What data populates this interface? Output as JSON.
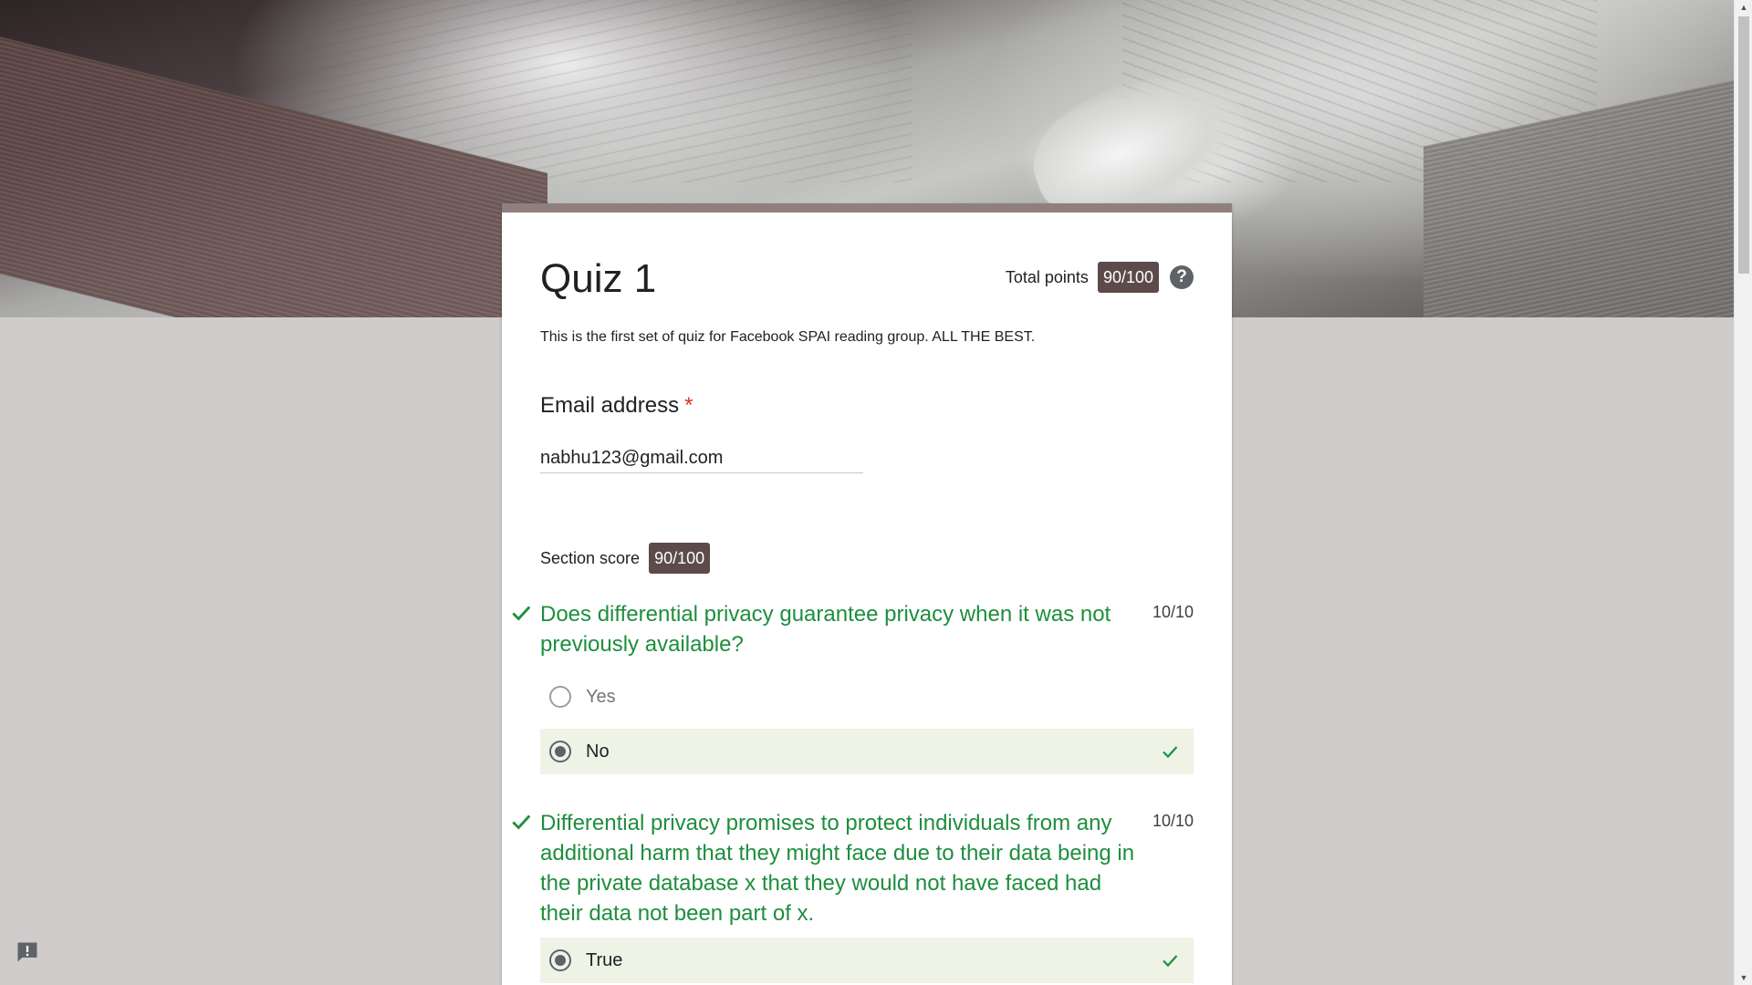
{
  "form": {
    "title": "Quiz 1",
    "total_points_label": "Total points",
    "total_points_value": "90/100",
    "help_glyph": "?",
    "description": "This is the first set of quiz for Facebook SPAI reading group. ALL THE BEST."
  },
  "email": {
    "label": "Email address",
    "required_mark": "*",
    "value": "nabhu123@gmail.com"
  },
  "section": {
    "label": "Section score",
    "value": "90/100"
  },
  "questions": [
    {
      "text": "Does differential privacy guarantee privacy when it was not previously available?",
      "points": "10/10",
      "options": [
        {
          "label": "Yes",
          "selected": false,
          "correct": false
        },
        {
          "label": "No",
          "selected": true,
          "correct": true
        }
      ]
    },
    {
      "text": "Differential privacy promises to protect individuals from any additional harm that they might face due to their data being in the private database x that they would not have faced had their data not been part of x.",
      "points": "10/10",
      "options": [
        {
          "label": "True",
          "selected": true,
          "correct": true
        }
      ]
    }
  ],
  "colors": {
    "theme": "#8f7f7d",
    "badge": "#5c4b4a",
    "correct_green": "#1e8e3e",
    "correct_bg": "#eef3e6",
    "page_bg": "#d0cccb"
  },
  "icons": {
    "help": "help-circle-icon",
    "correct": "checkmark-icon",
    "feedback": "report-feedback-icon"
  }
}
